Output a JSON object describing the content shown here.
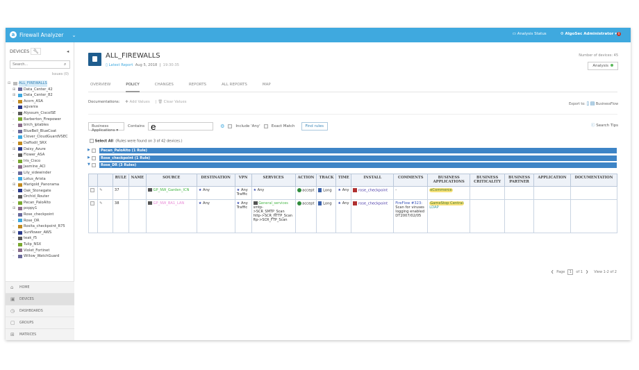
{
  "app": {
    "title": "Firewall Analyzer",
    "analysis_status": "Analysis Status",
    "user": "AlgoSec Administrator",
    "notification_count": "0"
  },
  "sidebar": {
    "header": "DEVICES",
    "search_placeholder": "Search...",
    "issues": "Issues (0)",
    "tree": [
      {
        "label": "ALL_FIREWALLS",
        "exp": "⊟",
        "root": true
      },
      {
        "label": "Data_Center_42",
        "exp": "⊞"
      },
      {
        "label": "Data_Center_82",
        "exp": "⊞"
      },
      {
        "label": "Acorn_ASA"
      },
      {
        "label": "agvania"
      },
      {
        "label": "Alyssum_CiscoISE"
      },
      {
        "label": "Barberton_Firepower"
      },
      {
        "label": "birch_iptables"
      },
      {
        "label": "BlueBell_BlueCoat"
      },
      {
        "label": "Clover_CloudGuardVSEC"
      },
      {
        "label": "Daffodil_SRX"
      },
      {
        "label": "Daisy_Azure",
        "exp": "⊞"
      },
      {
        "label": "Flower_ASA"
      },
      {
        "label": "Iris_Cisco"
      },
      {
        "label": "Jasmine_ACI"
      },
      {
        "label": "Lily_sidewinder"
      },
      {
        "label": "Lotus_Arista"
      },
      {
        "label": "Marigold_Panorama",
        "exp": "⊞"
      },
      {
        "label": "Oak_Stonegate"
      },
      {
        "label": "Orchid_Router"
      },
      {
        "label": "Pecan_PaloAlto"
      },
      {
        "label": "poppy1",
        "exp": "⊞"
      },
      {
        "label": "Rose_checkpoint"
      },
      {
        "label": "Rose_DR"
      },
      {
        "label": "Rosita_checkpoint_R75"
      },
      {
        "label": "Sunflower_AWS",
        "exp": "⊞"
      },
      {
        "label": "teak_f5"
      },
      {
        "label": "Tulip_NSX"
      },
      {
        "label": "Violet_Fortinet"
      },
      {
        "label": "Willow_WatchGuard"
      }
    ],
    "nav": [
      {
        "label": "HOME",
        "icon": "⌂"
      },
      {
        "label": "DEVICES",
        "icon": "▣",
        "active": true
      },
      {
        "label": "DASHBOARDS",
        "icon": "◷"
      },
      {
        "label": "GROUPS",
        "icon": "▢"
      },
      {
        "label": "MATRICES",
        "icon": "⊞"
      }
    ]
  },
  "main": {
    "title": "ALL_FIREWALLS",
    "latest_report": "Latest Report",
    "date": "Aug 5, 2018",
    "time": "19:30:35",
    "num_devices": "Number of devices: 45",
    "analysis_button": "Analysis",
    "tabs": [
      "OVERVIEW",
      "POLICY",
      "CHANGES",
      "REPORTS",
      "ALL REPORTS",
      "MAP"
    ],
    "documentations": "Documentations:",
    "add_values": "Add Values",
    "clear_values": "Clear Values",
    "export_to": "Export to:",
    "businessflow": "BusinessFlow",
    "filter": {
      "field": "Business Applications",
      "op": "Contains",
      "value": "e",
      "include_any": "Include 'Any'",
      "exact_match": "Exact Match",
      "find": "Find rules",
      "search_tips": "Search Tips"
    },
    "select_all": "Select All",
    "found": "(Rules were found on 3 of 42 devices.)",
    "groups": [
      "Pecan_PaloAlto (1 Rule)",
      "Rose_checkpoint (1 Rule)",
      "Rose_DR (3 Rules)"
    ],
    "columns": [
      "",
      "",
      "RULE",
      "NAME",
      "SOURCE",
      "DESTINATION",
      "VPN",
      "SERVICES",
      "ACTION",
      "TRACK",
      "TIME",
      "INSTALL",
      "COMMENTS",
      "BUSINESS APPLICATIONS",
      "BUSINESS CRITICALITY",
      "BUSINESS PARTNER",
      "APPLICATION",
      "DOCUMENTATION"
    ],
    "rows": [
      {
        "rule": "37",
        "source": "GP_NW_Garden_ICN",
        "destination": "Any",
        "vpn": "Any Traffic",
        "services": [
          "Any"
        ],
        "action": "accept",
        "track": "Long",
        "time": "Any",
        "install": "rose_checkpoint",
        "comments_link": "",
        "comments": "-",
        "bapps": [
          "eCommerce"
        ]
      },
      {
        "rule": "38",
        "source": "GP_NW_BA1_LAN",
        "destination": "Any",
        "vpn": "Any Traffic",
        "services": [
          "General_services",
          "smtp->SCR_SMTP_Scan",
          "http->SCR_HTTP_Scan",
          "ftp->SCR_FTP_Scan"
        ],
        "action": "accept",
        "track": "Long",
        "time": "Any",
        "install": "rose_checkpoint",
        "comments_link": "FireFlow #323:",
        "comments": "Scan for viruses logging enabled DT2007/02/05",
        "bapps": [
          "GameStop Central",
          "LDAP"
        ]
      }
    ],
    "pager": {
      "page": "Page",
      "current": "1",
      "of": "of 1",
      "view": "View 1-2 of 2"
    }
  }
}
